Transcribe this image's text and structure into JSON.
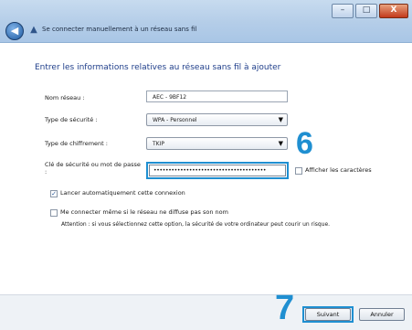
{
  "window": {
    "title": "Se connecter manuellement à un réseau sans fil",
    "controls": {
      "minimize": "–",
      "maximize": "□",
      "close": "X"
    }
  },
  "heading": "Entrer les informations relatives au réseau sans fil à ajouter",
  "form": {
    "network_name_label": "Nom réseau :",
    "network_name_value": "AEC - 9BF12",
    "security_type_label": "Type de sécurité :",
    "security_type_value": "WPA - Personnel",
    "encryption_type_label": "Type de chiffrement :",
    "encryption_type_value": "TKIP",
    "key_label": "Clé de sécurité ou mot de passe :",
    "key_value": "••••••••••••••••••••••••••••••••••••••",
    "show_chars_label": "Afficher les caractères",
    "auto_connect_label": "Lancer automatiquement cette connexion",
    "auto_connect_checked": true,
    "connect_hidden_label": "Me connecter même si le réseau ne diffuse pas son nom",
    "connect_hidden_checked": false,
    "warning": "Attention : si vous sélectionnez cette option, la sécurité de votre ordinateur peut courir un risque."
  },
  "steps": {
    "step_key": "6",
    "step_next": "7"
  },
  "buttons": {
    "next": "Suivant",
    "cancel": "Annuler"
  },
  "colors": {
    "highlight": "#1f8fd1",
    "heading": "#1f3e8a"
  },
  "icons": {
    "back": "back-arrow-icon",
    "network": "wireless-network-icon",
    "select_arrow": "chevron-down-icon"
  }
}
